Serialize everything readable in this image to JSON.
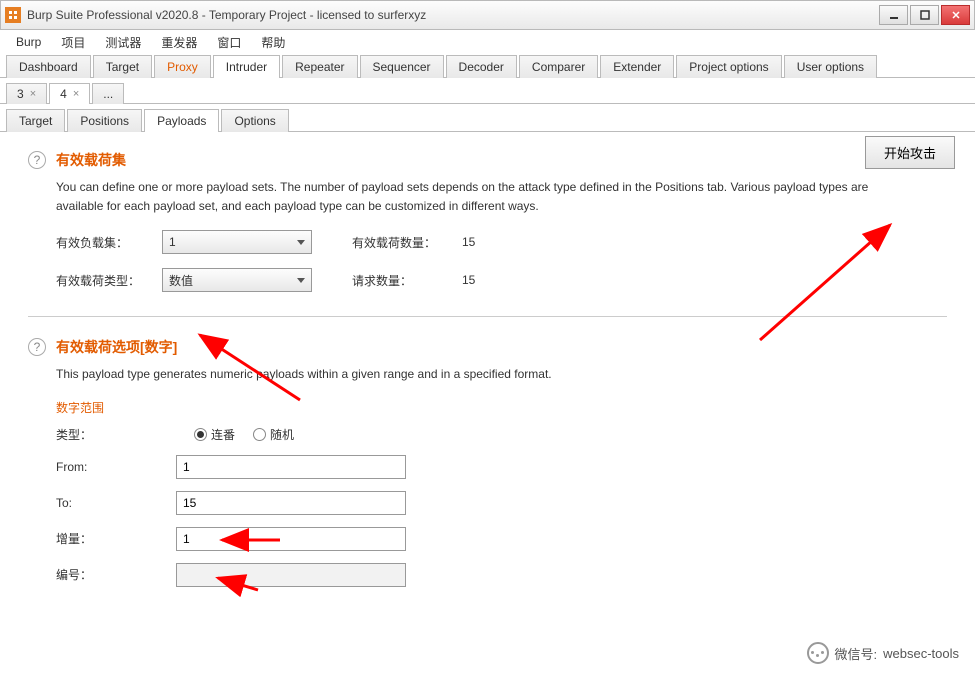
{
  "window": {
    "title": "Burp Suite Professional v2020.8 - Temporary Project - licensed to surferxyz"
  },
  "menubar": [
    "Burp",
    "项目",
    "测试器",
    "重发器",
    "窗口",
    "帮助"
  ],
  "main_tabs": [
    "Dashboard",
    "Target",
    "Proxy",
    "Intruder",
    "Repeater",
    "Sequencer",
    "Decoder",
    "Comparer",
    "Extender",
    "Project options",
    "User options"
  ],
  "main_tab_active_index": 3,
  "main_tab_highlight_index": 2,
  "request_tabs": [
    {
      "label": "3",
      "closable": true
    },
    {
      "label": "4",
      "closable": true
    },
    {
      "label": "...",
      "closable": false
    }
  ],
  "request_tab_active_index": 1,
  "inner_tabs": [
    "Target",
    "Positions",
    "Payloads",
    "Options"
  ],
  "inner_tab_active_index": 2,
  "start_button": "开始攻击",
  "section1": {
    "title": "有效载荷集",
    "desc": "You can define one or more payload sets. The number of payload sets depends on the attack type defined in the Positions tab. Various payload types are available for each payload set, and each payload type can be customized in different ways.",
    "row1_label": "有效负载集：",
    "row1_value": "1",
    "row1_stat_label": "有效载荷数量：",
    "row1_stat_value": "15",
    "row2_label": "有效载荷类型：",
    "row2_value": "数值",
    "row2_stat_label": "请求数量：",
    "row2_stat_value": "15"
  },
  "section2": {
    "title": "有效载荷选项[数字]",
    "desc": "This payload type generates numeric payloads within a given range and in a specified format.",
    "subhead": "数字范围",
    "type_label": "类型：",
    "radio_seq": "连番",
    "radio_rand": "随机",
    "from_label": "From:",
    "from_value": "1",
    "to_label": "To:",
    "to_value": "15",
    "step_label": "增量：",
    "step_value": "1",
    "num_label": "编号：",
    "num_value": ""
  },
  "watermark": {
    "label": "微信号:",
    "value": "websec-tools"
  }
}
